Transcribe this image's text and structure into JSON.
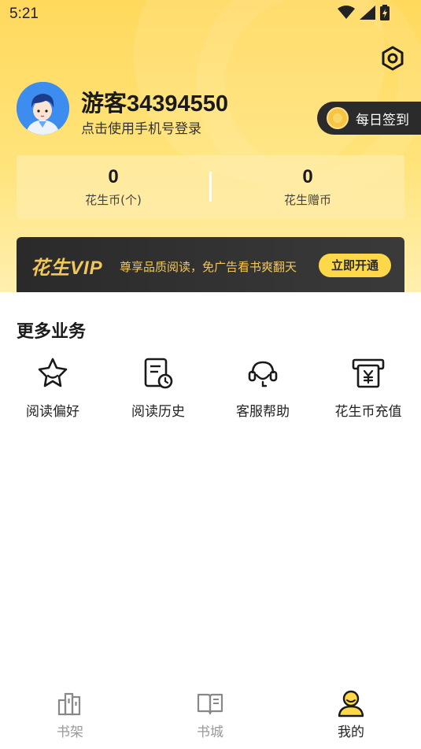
{
  "status_bar": {
    "time": "5:21"
  },
  "profile": {
    "username": "游客34394550",
    "login_hint": "点击使用手机号登录",
    "checkin_label": "每日签到"
  },
  "coins": [
    {
      "value": "0",
      "label": "花生币(个)"
    },
    {
      "value": "0",
      "label": "花生赠币"
    }
  ],
  "vip": {
    "logo": "花生VIP",
    "slogan": "尊享品质阅读，免广告看书爽翻天",
    "button": "立即开通"
  },
  "more_services": {
    "title": "更多业务",
    "items": [
      {
        "label": "阅读偏好",
        "icon": "star-icon"
      },
      {
        "label": "阅读历史",
        "icon": "history-icon"
      },
      {
        "label": "客服帮助",
        "icon": "headset-icon"
      },
      {
        "label": "花生币充值",
        "icon": "recharge-icon"
      }
    ]
  },
  "tabbar": {
    "items": [
      {
        "label": "书架",
        "icon": "bookshelf-icon",
        "active": false
      },
      {
        "label": "书城",
        "icon": "book-icon",
        "active": false
      },
      {
        "label": "我的",
        "icon": "user-icon",
        "active": true
      }
    ]
  },
  "colors": {
    "accent": "#ffd84a",
    "vip_gold": "#f3c65a",
    "dark": "#2b2b2b",
    "tab_inactive": "#999999"
  }
}
